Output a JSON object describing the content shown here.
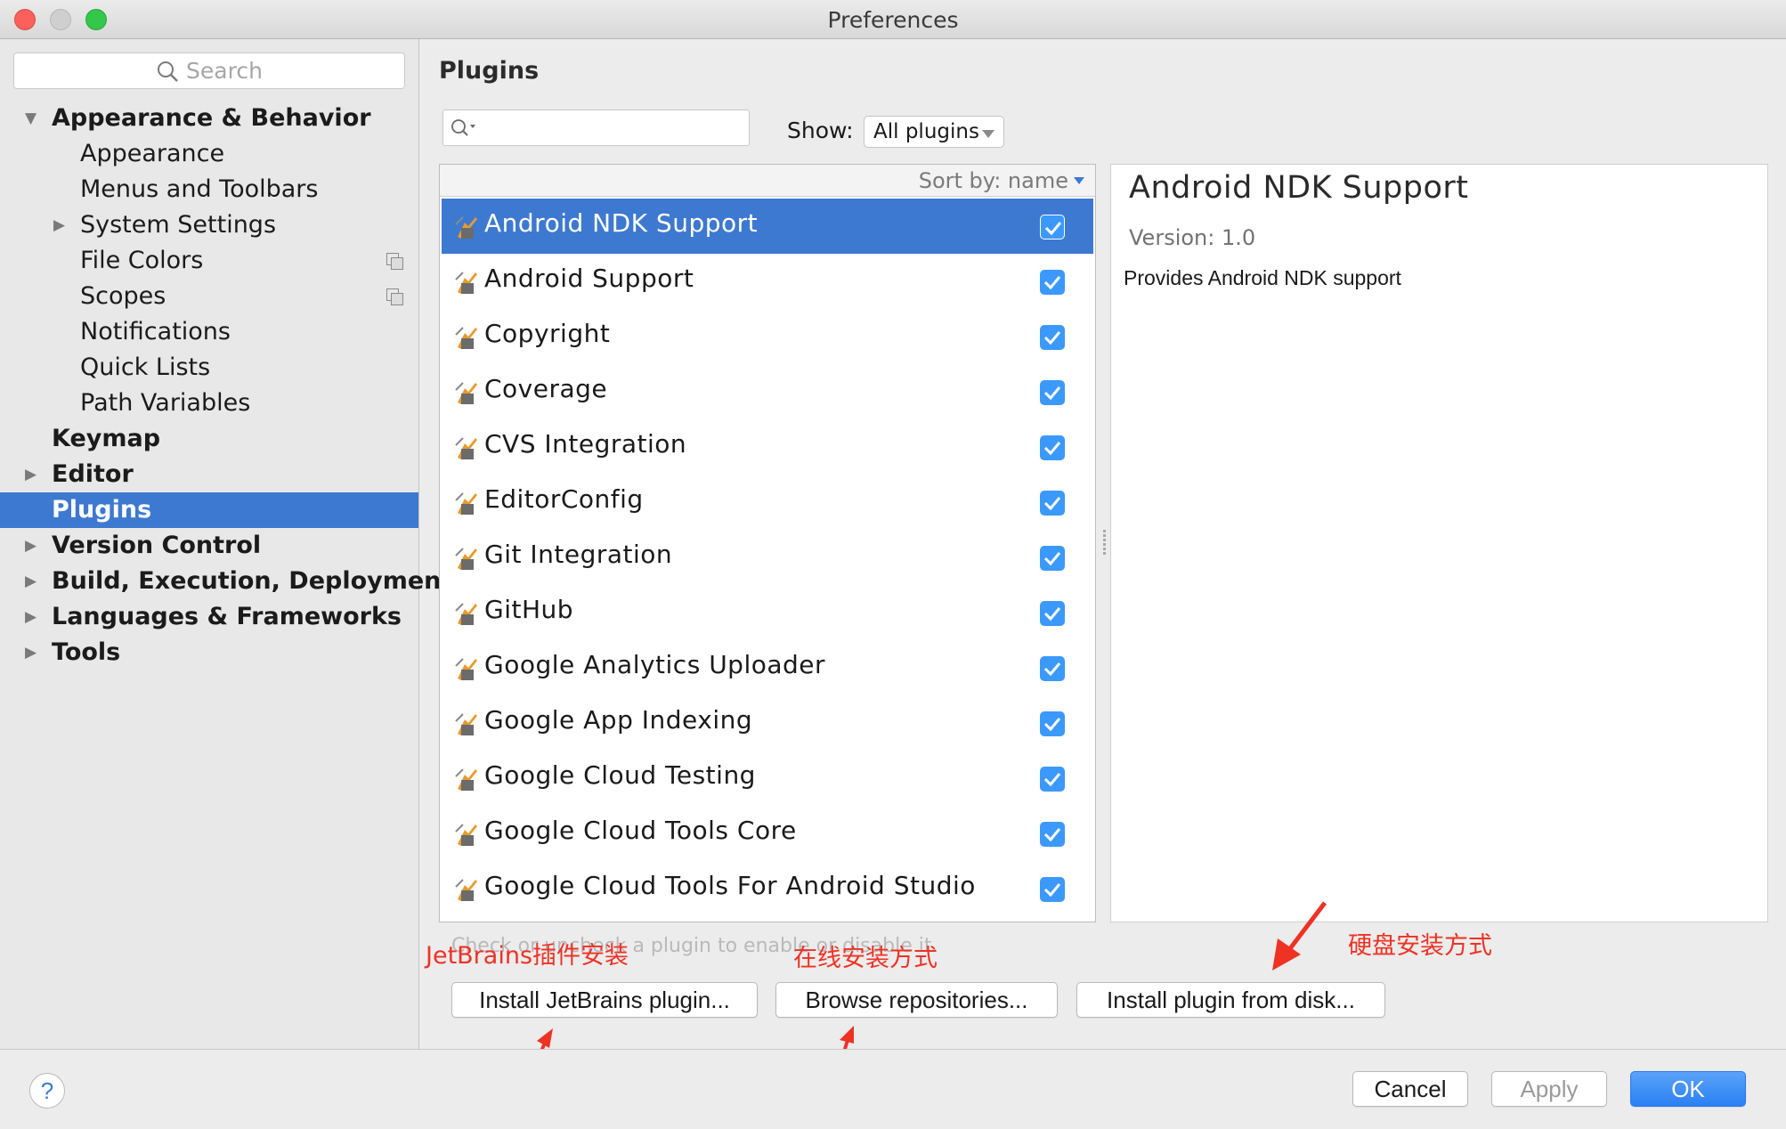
{
  "window": {
    "title": "Preferences"
  },
  "sidebar": {
    "search_placeholder": "Search",
    "items": [
      {
        "label": "Appearance & Behavior",
        "level": 0,
        "bold": true,
        "expanded": true,
        "arrow": "▼",
        "name": "sidebar-item-appearance-behavior"
      },
      {
        "label": "Appearance",
        "level": 1,
        "name": "sidebar-item-appearance"
      },
      {
        "label": "Menus and Toolbars",
        "level": 1,
        "name": "sidebar-item-menus-toolbars"
      },
      {
        "label": "System Settings",
        "level": 1,
        "arrow": "▶",
        "name": "sidebar-item-system-settings"
      },
      {
        "label": "File Colors",
        "level": 1,
        "copy_icon": true,
        "name": "sidebar-item-file-colors"
      },
      {
        "label": "Scopes",
        "level": 1,
        "copy_icon": true,
        "name": "sidebar-item-scopes"
      },
      {
        "label": "Notifications",
        "level": 1,
        "name": "sidebar-item-notifications"
      },
      {
        "label": "Quick Lists",
        "level": 1,
        "name": "sidebar-item-quick-lists"
      },
      {
        "label": "Path Variables",
        "level": 1,
        "name": "sidebar-item-path-variables"
      },
      {
        "label": "Keymap",
        "level": 0,
        "bold": true,
        "name": "sidebar-item-keymap"
      },
      {
        "label": "Editor",
        "level": 0,
        "bold": true,
        "arrow": "▶",
        "name": "sidebar-item-editor"
      },
      {
        "label": "Plugins",
        "level": 0,
        "bold": true,
        "selected": true,
        "name": "sidebar-item-plugins"
      },
      {
        "label": "Version Control",
        "level": 0,
        "bold": true,
        "arrow": "▶",
        "name": "sidebar-item-version-control"
      },
      {
        "label": "Build, Execution, Deployment",
        "level": 0,
        "bold": true,
        "arrow": "▶",
        "name": "sidebar-item-build-execution-deployment"
      },
      {
        "label": "Languages & Frameworks",
        "level": 0,
        "bold": true,
        "arrow": "▶",
        "name": "sidebar-item-languages-frameworks"
      },
      {
        "label": "Tools",
        "level": 0,
        "bold": true,
        "arrow": "▶",
        "name": "sidebar-item-tools"
      }
    ]
  },
  "main": {
    "title": "Plugins",
    "show_label": "Show:",
    "show_value": "All plugins",
    "sort_label": "Sort by: name",
    "plugins": [
      {
        "name": "Android NDK Support",
        "enabled": true,
        "selected": true
      },
      {
        "name": "Android Support",
        "enabled": true
      },
      {
        "name": "Copyright",
        "enabled": true
      },
      {
        "name": "Coverage",
        "enabled": true
      },
      {
        "name": "CVS Integration",
        "enabled": true
      },
      {
        "name": "EditorConfig",
        "enabled": true
      },
      {
        "name": "Git Integration",
        "enabled": true
      },
      {
        "name": "GitHub",
        "enabled": true
      },
      {
        "name": "Google Analytics Uploader",
        "enabled": true
      },
      {
        "name": "Google App Indexing",
        "enabled": true
      },
      {
        "name": "Google Cloud Testing",
        "enabled": true
      },
      {
        "name": "Google Cloud Tools Core",
        "enabled": true
      },
      {
        "name": "Google Cloud Tools For Android Studio",
        "enabled": true
      }
    ],
    "detail": {
      "name": "Android NDK Support",
      "version": "Version: 1.0",
      "description": "Provides Android NDK support"
    },
    "hint": "Check or uncheck a plugin to enable or disable it.",
    "buttons": {
      "install_jetbrains": "Install JetBrains plugin...",
      "browse": "Browse repositories...",
      "install_disk": "Install plugin from disk..."
    },
    "annotations": {
      "jetbrains": "JetBrains插件安装",
      "online": "在线安装方式",
      "disk": "硬盘安装方式"
    }
  },
  "footer": {
    "help": "?",
    "cancel": "Cancel",
    "apply": "Apply",
    "ok": "OK"
  },
  "colors": {
    "accent": "#3d79d0",
    "checkbox": "#3b99fc",
    "annotation": "#ee3224"
  }
}
